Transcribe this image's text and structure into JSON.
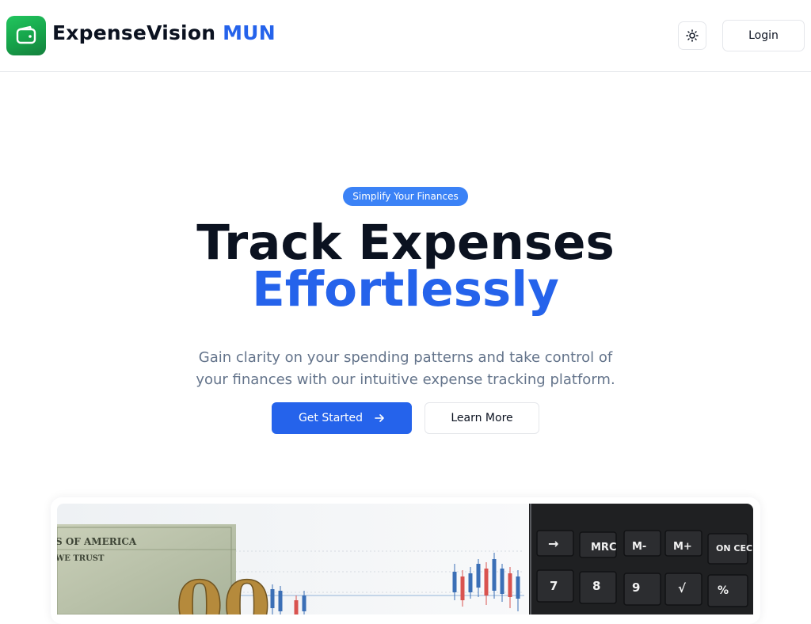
{
  "header": {
    "brand_name": "ExpenseVision",
    "brand_accent": "MUN",
    "login_label": "Login"
  },
  "hero": {
    "badge": "Simplify Your Finances",
    "headline_line1": "Track Expenses",
    "headline_line2": "Effortlessly",
    "subtitle": "Gain clarity on your spending patterns and take control of your finances with our intuitive expense tracking platform.",
    "primary_cta": "Get Started",
    "secondary_cta": "Learn More"
  },
  "hero_image": {
    "banknote_text_1": "S OF AMERICA",
    "banknote_text_2": "WE TRUST",
    "banknote_value": "00",
    "keys_row1": [
      "→",
      "MRC",
      "M-",
      "M+",
      "ON CEC"
    ],
    "keys_row2": [
      "7",
      "8",
      "9",
      "√",
      "%"
    ]
  },
  "icons": {
    "logo": "wallet-icon",
    "theme_toggle": "sun-icon",
    "cta_arrow": "arrow-right-icon"
  },
  "colors": {
    "brand_green": "#16a34a",
    "accent_blue": "#2563eb",
    "badge_blue": "#3b82f6",
    "text_dark": "#0b1220",
    "text_muted": "#64748b",
    "border": "#e5e7eb"
  }
}
